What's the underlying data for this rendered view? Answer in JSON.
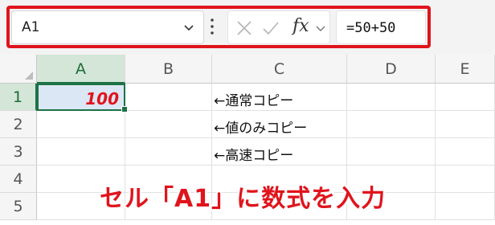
{
  "formula_bar": {
    "name_box": "A1",
    "fx_label": "fx",
    "formula": "=50+50"
  },
  "columns": [
    "A",
    "B",
    "C",
    "D",
    "E"
  ],
  "rows": [
    "1",
    "2",
    "3",
    "4",
    "5"
  ],
  "cells": {
    "A1": "100"
  },
  "notes": [
    "←通常コピー",
    "←値のみコピー",
    "←高速コピー"
  ],
  "caption": "セル「A1」に数式を入力",
  "colors": {
    "highlight_border": "#e0141c",
    "selection_green": "#1e7145",
    "active_cell_fill": "#dbe7f5"
  },
  "icons": {
    "name_box_dropdown": "chevron-down-icon",
    "more_options": "vertical-dots-icon",
    "cancel": "x-icon",
    "enter": "check-icon",
    "insert_function": "fx-icon"
  }
}
